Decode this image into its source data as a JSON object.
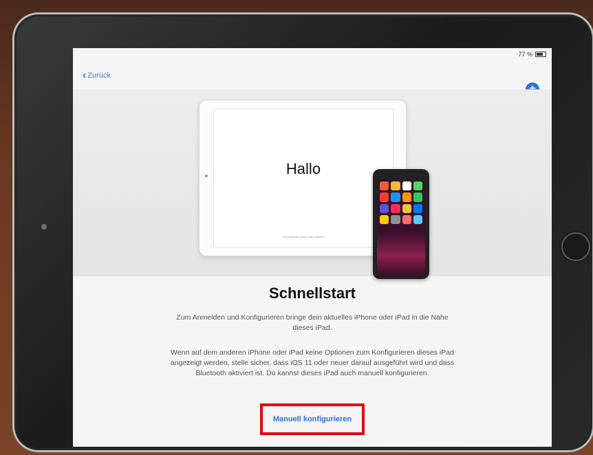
{
  "status": {
    "battery_text": "77 %"
  },
  "nav": {
    "back_label": "Zurück",
    "accessibility_icon": "accessibility-icon"
  },
  "illustration": {
    "ipad_greeting": "Hallo",
    "ipad_footnote": "Zum Beenden deine Taste drücken",
    "app_colors": [
      "#f25c3a",
      "#f7b733",
      "#ffffff",
      "#4cd964",
      "#ff3b30",
      "#1e90ff",
      "#ff9500",
      "#34c759",
      "#5856d6",
      "#ff2d55",
      "#f5c542",
      "#007aff",
      "#ffcc00",
      "#8e8e93",
      "#ff6b6b",
      "#5ac8fa"
    ]
  },
  "content": {
    "title": "Schnellstart",
    "paragraph1": "Zum Anmelden und Konfigurieren bringe dein aktuelles iPhone oder iPad in die Nähe dieses iPad.",
    "paragraph2": "Wenn auf dem anderen iPhone oder iPad keine Optionen zum Konfigurieren dieses iPad angezeigt werden, stelle sicher, dass iOS 11 oder neuer darauf ausgeführt wird und dass Bluetooth aktiviert ist. Du kannst dieses iPad auch manuell konfigurieren.",
    "manual_button_label": "Manuell konfigurieren"
  },
  "colors": {
    "accent": "#2f6fd6",
    "highlight_box": "#e60012"
  }
}
